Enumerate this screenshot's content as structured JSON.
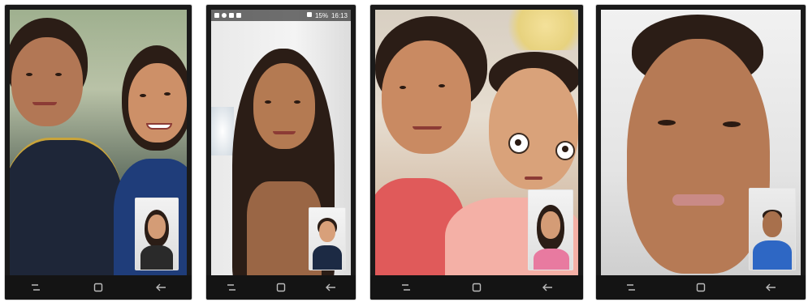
{
  "status_bar": {
    "battery": "15%",
    "time": "16:13"
  },
  "screens": [
    {
      "label": "video-call-screen-1"
    },
    {
      "label": "video-call-screen-2"
    },
    {
      "label": "video-call-screen-3"
    },
    {
      "label": "video-call-screen-4"
    }
  ],
  "navbar": {
    "recents_icon": "recent-apps-icon",
    "home_icon": "home-icon",
    "back_icon": "back-arrow-icon"
  },
  "colors": {
    "nav_bg": "#141414",
    "phone_frame": "#1a1a1a",
    "shirt_blue": "#1f3d7a",
    "shirt_pink": "#e87aa0",
    "shirt_navy": "#1c2a44"
  }
}
